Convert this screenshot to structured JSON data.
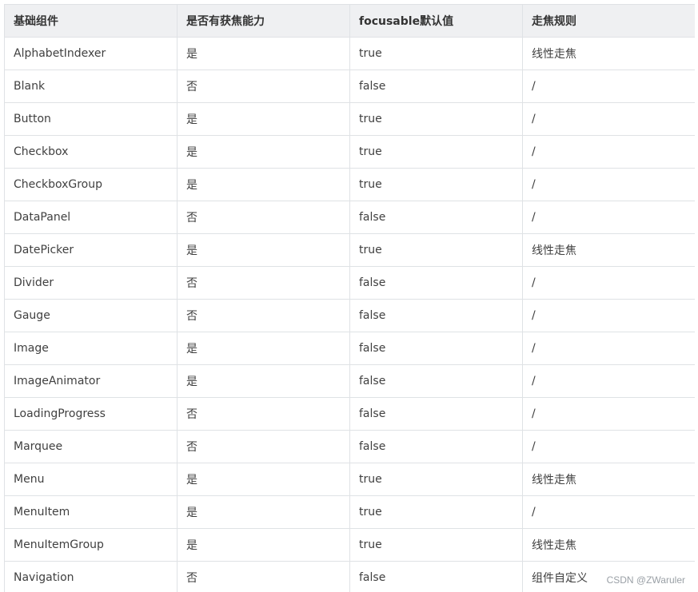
{
  "table": {
    "headers": [
      "基础组件",
      "是否有获焦能力",
      "focusable默认值",
      "走焦规则"
    ],
    "rows": [
      [
        "AlphabetIndexer",
        "是",
        "true",
        "线性走焦"
      ],
      [
        "Blank",
        "否",
        "false",
        "/"
      ],
      [
        "Button",
        "是",
        "true",
        "/"
      ],
      [
        "Checkbox",
        "是",
        "true",
        "/"
      ],
      [
        "CheckboxGroup",
        "是",
        "true",
        "/"
      ],
      [
        "DataPanel",
        "否",
        "false",
        "/"
      ],
      [
        "DatePicker",
        "是",
        "true",
        "线性走焦"
      ],
      [
        "Divider",
        "否",
        "false",
        "/"
      ],
      [
        "Gauge",
        "否",
        "false",
        "/"
      ],
      [
        "Image",
        "是",
        "false",
        "/"
      ],
      [
        "ImageAnimator",
        "是",
        "false",
        "/"
      ],
      [
        "LoadingProgress",
        "否",
        "false",
        "/"
      ],
      [
        "Marquee",
        "否",
        "false",
        "/"
      ],
      [
        "Menu",
        "是",
        "true",
        "线性走焦"
      ],
      [
        "MenuItem",
        "是",
        "true",
        "/"
      ],
      [
        "MenuItemGroup",
        "是",
        "true",
        "线性走焦"
      ],
      [
        "Navigation",
        "否",
        "false",
        "组件自定义"
      ]
    ]
  },
  "watermark": "CSDN @ZWaruler"
}
